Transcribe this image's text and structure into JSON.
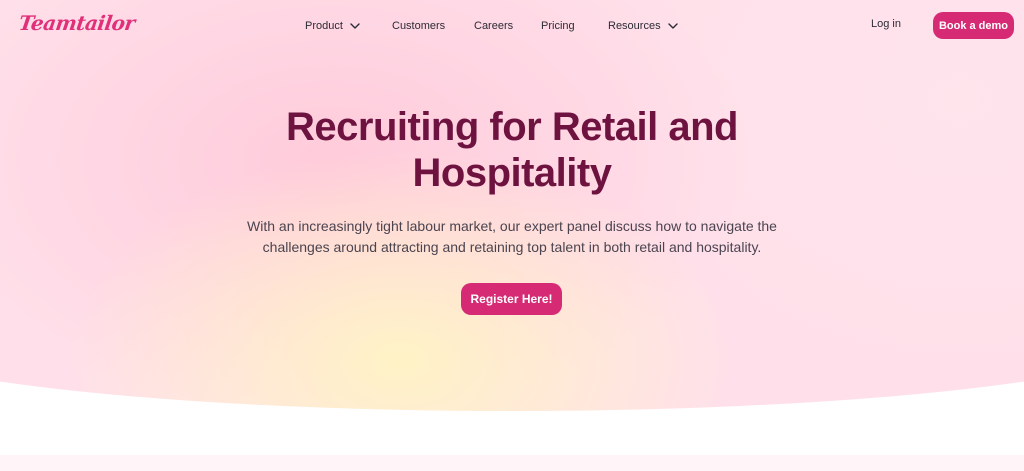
{
  "brand": {
    "logo_text": "Teamtailor",
    "accent_color": "#d62b74",
    "title_color": "#6e1240"
  },
  "nav": {
    "items": [
      {
        "label": "Product",
        "has_dropdown": true
      },
      {
        "label": "Customers",
        "has_dropdown": false
      },
      {
        "label": "Careers",
        "has_dropdown": false
      },
      {
        "label": "Pricing",
        "has_dropdown": false
      },
      {
        "label": "Resources",
        "has_dropdown": true
      }
    ],
    "login_label": "Log in",
    "demo_label": "Book a demo"
  },
  "hero": {
    "title_line1": "Recruiting for Retail and",
    "title_line2": "Hospitality",
    "subtitle_line1": "With an increasingly tight labour market, our expert panel discuss how to navigate the",
    "subtitle_line2": "challenges around attracting and retaining top talent in both retail and hospitality.",
    "cta_label": "Register Here!"
  },
  "icons": {
    "dropdown": "chevron-down-icon"
  }
}
